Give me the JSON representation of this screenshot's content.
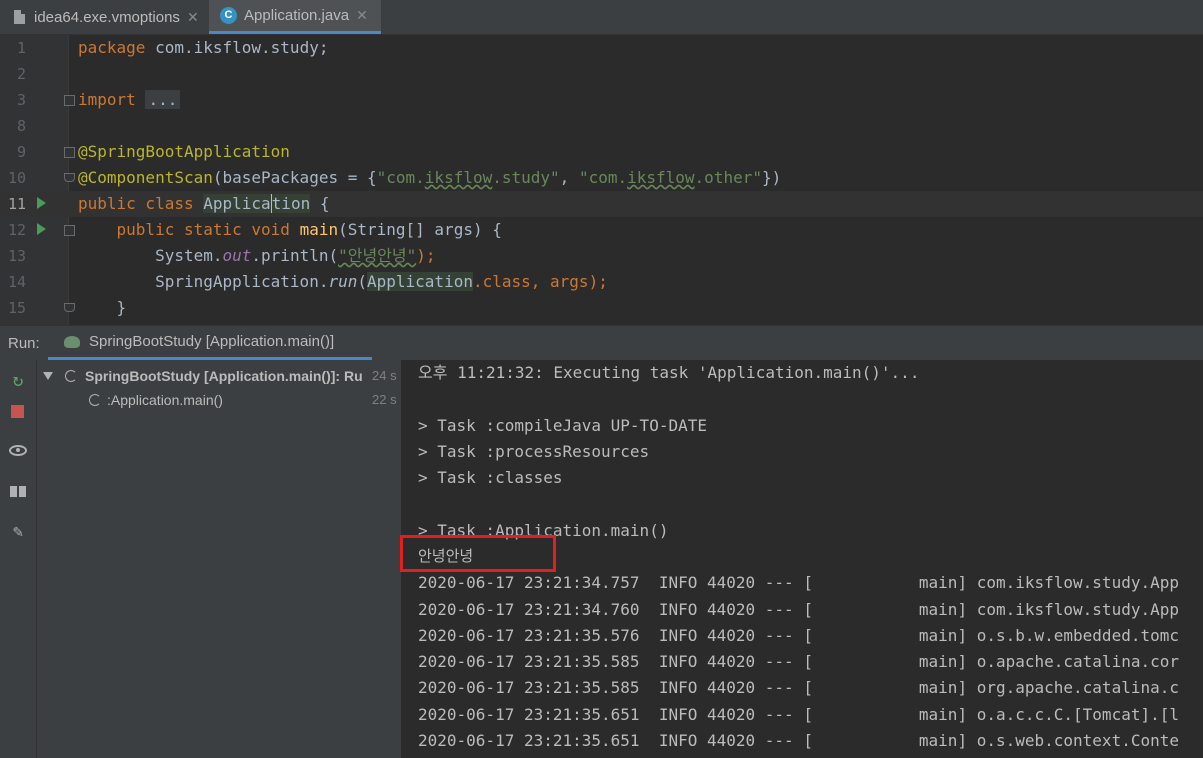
{
  "tabs": [
    {
      "label": "idea64.exe.vmoptions",
      "icon": "file-icon",
      "close": "✕"
    },
    {
      "label": "Application.java",
      "icon": "java-class-icon",
      "close": "✕"
    }
  ],
  "editor": {
    "line_numbers": [
      "1",
      "2",
      "3",
      "8",
      "9",
      "10",
      "11",
      "12",
      "13",
      "14",
      "15"
    ],
    "package_kw": "package",
    "package_name": " com.iksflow.study;",
    "import_kw": "import",
    "import_fold": "...",
    "ann1": "@SpringBootApplication",
    "ann2": "@ComponentScan",
    "ann2_open": "(basePackages = {",
    "pkg1_q1": "\"com.",
    "pkg1_mid": "iksflow",
    "pkg1_q2": ".study\"",
    "comma": ", ",
    "pkg2_q1": "\"com.",
    "pkg2_mid": "iksflow",
    "pkg2_q2": ".other\"",
    "ann2_close": "})",
    "class_kw": "public class ",
    "class_name_a": "Applica",
    "class_name_b": "tion",
    "class_open": " {",
    "main_kw": "public static void ",
    "main_fn": "main",
    "main_args": "(String[] args) {",
    "sys": "System.",
    "out": "out",
    "println": ".println(",
    "str_korean": "\"안녕안녕\"",
    "println_end": ");",
    "springapp": "SpringApplication.",
    "run": "run",
    "run_open": "(",
    "app_ref": "Application",
    "class_ref": ".class",
    "run_args": ", args);",
    "brace_close": "}"
  },
  "run_panel": {
    "label": "Run:",
    "tab": "SpringBootStudy [Application.main()]",
    "tree": [
      {
        "text": "SpringBootStudy [Application.main()]: Ru",
        "time": "24 s"
      },
      {
        "text": ":Application.main()",
        "time": "22 s"
      }
    ]
  },
  "console": {
    "lines": [
      "오후 11:21:32: Executing task 'Application.main()'...",
      "",
      "> Task :compileJava UP-TO-DATE",
      "> Task :processResources",
      "> Task :classes",
      "",
      "> Task :Application.main()",
      "안녕안녕",
      "2020-06-17 23:21:34.757  INFO 44020 --- [           main] com.iksflow.study.App",
      "2020-06-17 23:21:34.760  INFO 44020 --- [           main] com.iksflow.study.App",
      "2020-06-17 23:21:35.576  INFO 44020 --- [           main] o.s.b.w.embedded.tomc",
      "2020-06-17 23:21:35.585  INFO 44020 --- [           main] o.apache.catalina.cor",
      "2020-06-17 23:21:35.585  INFO 44020 --- [           main] org.apache.catalina.c",
      "2020-06-17 23:21:35.651  INFO 44020 --- [           main] o.a.c.c.C.[Tomcat].[l",
      "2020-06-17 23:21:35.651  INFO 44020 --- [           main] o.s.web.context.Conte"
    ]
  },
  "colors": {
    "highlight_box": "#e01f1f",
    "tab_accent": "#4a88c7"
  }
}
